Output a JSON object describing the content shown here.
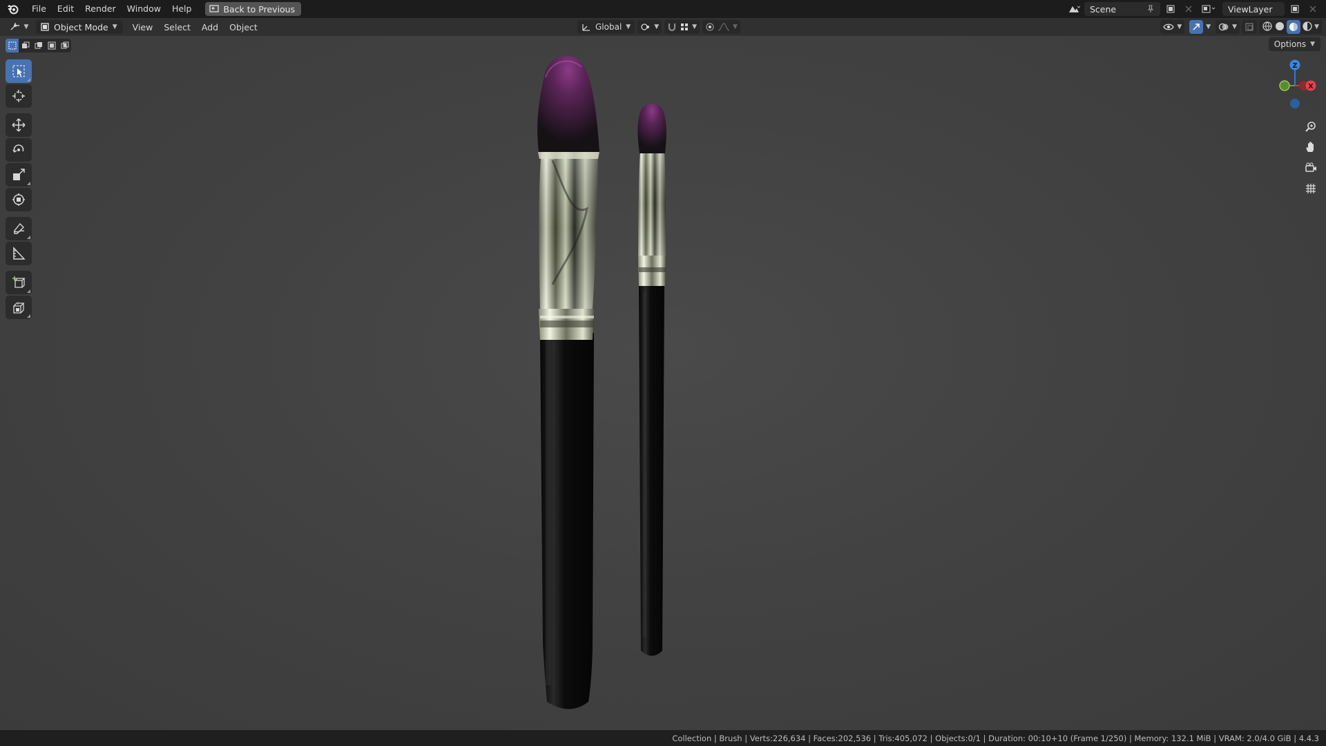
{
  "topbar": {
    "menu": [
      "File",
      "Edit",
      "Render",
      "Window",
      "Help"
    ],
    "back_button": "Back to Previous",
    "scene": "Scene",
    "view_layer": "ViewLayer"
  },
  "header": {
    "mode": "Object Mode",
    "menus": [
      "View",
      "Select",
      "Add",
      "Object"
    ],
    "transform_orientation": "Global"
  },
  "viewport": {
    "options_label": "Options",
    "gizmo_axes": {
      "x": "X",
      "y": "Y",
      "z": "Z"
    },
    "scene_colors": {
      "background": "#424242",
      "bristles": "#6b2a66",
      "handle": "#111111",
      "ferrule": "#c9ccb8"
    }
  },
  "status": {
    "text": "Collection | Brush | Verts:226,634 | Faces:202,536 | Tris:405,072 | Objects:0/1 | Duration: 00:10+10 (Frame 1/250) | Memory: 132.1 MiB | VRAM: 2.0/4.0 GiB | 4.4.3"
  },
  "icons": {
    "tools": [
      "select-box-icon",
      "cursor-icon",
      "move-icon",
      "rotate-icon",
      "scale-icon",
      "transform-icon",
      "annotate-icon",
      "measure-icon",
      "add-cube-icon",
      "extrude-icon"
    ],
    "nav": [
      "zoom-icon",
      "pan-hand-icon",
      "camera-icon",
      "ortho-grid-icon"
    ]
  }
}
